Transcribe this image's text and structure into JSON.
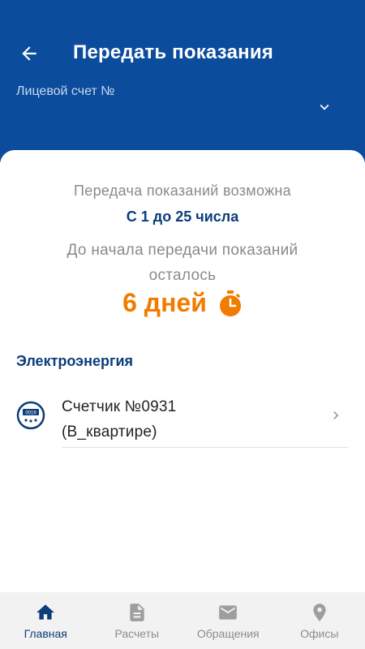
{
  "header": {
    "title": "Передать показания",
    "account_label": "Лицевой счет №"
  },
  "info": {
    "possible_text": "Передача показаний возможна",
    "period_text": "С 1 до 25 числа",
    "remaining_text": "До начала передачи показаний осталось",
    "days_value": "6 дней"
  },
  "section": {
    "title": "Электроэнергия"
  },
  "meter": {
    "name": "Счетчик №0931",
    "location": "(В_квартире)",
    "icon_reading": "0019"
  },
  "nav": {
    "items": [
      {
        "label": "Главная",
        "icon": "home-icon"
      },
      {
        "label": "Расчеты",
        "icon": "document-icon"
      },
      {
        "label": "Обращения",
        "icon": "mail-icon"
      },
      {
        "label": "Офисы",
        "icon": "location-pin-icon"
      }
    ],
    "active_index": 0
  },
  "colors": {
    "header_bg": "#0b4c9c",
    "primary_dark": "#0b3d7a",
    "accent_orange": "#f07c00",
    "muted_text": "#8a8a8a",
    "nav_bg": "#f2f2f2"
  }
}
